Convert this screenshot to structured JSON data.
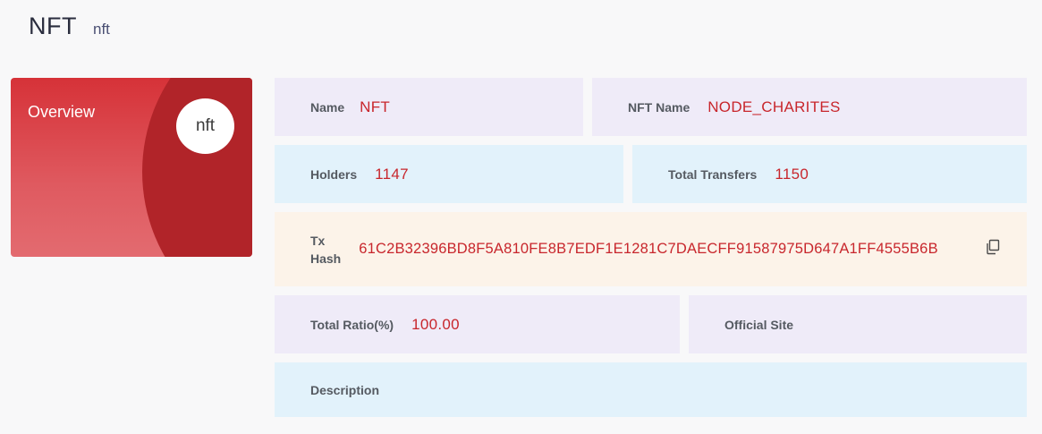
{
  "header": {
    "title": "NFT",
    "subtitle": "nft"
  },
  "overview": {
    "label": "Overview",
    "avatar_text": "nft"
  },
  "fields": {
    "name": {
      "label": "Name",
      "value": "NFT"
    },
    "nft_name": {
      "label": "NFT Name",
      "value": "NODE_CHARITES"
    },
    "holders": {
      "label": "Holders",
      "value": "1147"
    },
    "total_transfers": {
      "label": "Total Transfers",
      "value": "1150"
    },
    "tx_hash": {
      "label_line1": "Tx",
      "label_line2": "Hash",
      "value": "61C2B32396BD8F5A810FE8B7EDF1E1281C7DAECFF91587975D647A1FF4555B6B"
    },
    "total_ratio": {
      "label": "Total Ratio(%)",
      "value": "100.00"
    },
    "official_site": {
      "label": "Official Site",
      "value": ""
    },
    "description": {
      "label": "Description",
      "value": ""
    }
  },
  "icons": {
    "copy": "copy-icon"
  },
  "colors": {
    "accent": "#c8262c",
    "card_red": "#d63238",
    "card_dark": "#b12429",
    "lavender": "#efebf8",
    "sky": "#e2f2fb",
    "cream": "#fcf3e9"
  }
}
